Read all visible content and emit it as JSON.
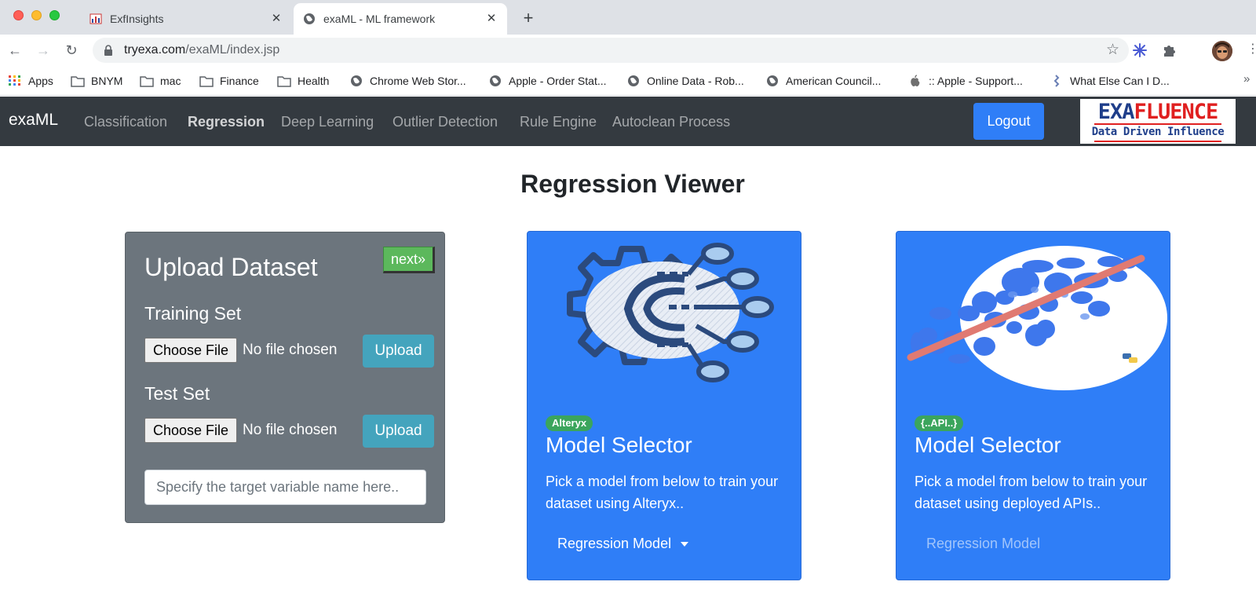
{
  "browser": {
    "tabs": [
      {
        "title": "ExfInsights",
        "close": "✕"
      },
      {
        "title": "exaML - ML framework",
        "close": "✕"
      }
    ],
    "new_tab": "+",
    "url_host": "tryexa.com",
    "url_path": "/exaML/index.jsp",
    "bookmarks": [
      {
        "label": "Apps",
        "icon": "apps-grid-icon"
      },
      {
        "label": "BNYM",
        "icon": "folder-icon"
      },
      {
        "label": "mac",
        "icon": "folder-icon"
      },
      {
        "label": "Finance",
        "icon": "folder-icon"
      },
      {
        "label": "Health",
        "icon": "folder-icon"
      },
      {
        "label": "Chrome Web Stor...",
        "icon": "globe-icon"
      },
      {
        "label": "Apple - Order Stat...",
        "icon": "globe-icon"
      },
      {
        "label": "Online Data - Rob...",
        "icon": "globe-icon"
      },
      {
        "label": "American Council...",
        "icon": "globe-icon"
      },
      {
        "label": ":: Apple - Support...",
        "icon": "apple-icon"
      },
      {
        "label": "What Else Can I D...",
        "icon": "ribbon-icon"
      }
    ],
    "more": "»"
  },
  "navbar": {
    "brand": "exaML",
    "links": [
      "Classification",
      "Regression",
      "Deep Learning",
      "Outlier Detection",
      "Rule Engine",
      "Autoclean Process"
    ],
    "active": "Regression",
    "logout": "Logout",
    "logo_exa": "EXA",
    "logo_fluence": "FLUENCE",
    "logo_tagline": "Data Driven Influence"
  },
  "page": {
    "title": "Regression Viewer"
  },
  "upload": {
    "title": "Upload Dataset",
    "next": "next»",
    "training_label": "Training Set",
    "test_label": "Test Set",
    "choose_file": "Choose File",
    "no_file": "No file chosen",
    "upload": "Upload",
    "target_placeholder": "Specify the target variable name here.."
  },
  "cards": [
    {
      "badge": "Alteryx",
      "title": "Model Selector",
      "description": "Pick a model from below to train your dataset using Alteryx..",
      "dropdown": "Regression Model"
    },
    {
      "badge": "{..API..}",
      "title": "Model Selector",
      "description": "Pick a model from below to train your dataset using deployed APIs..",
      "dropdown": "Regression Model"
    }
  ],
  "colors": {
    "navbar": "#343a40",
    "primary": "#2f7ef7",
    "secondary_card": "#6c757d",
    "info_button": "#44a4bd",
    "success_badge": "#3ba55c"
  }
}
